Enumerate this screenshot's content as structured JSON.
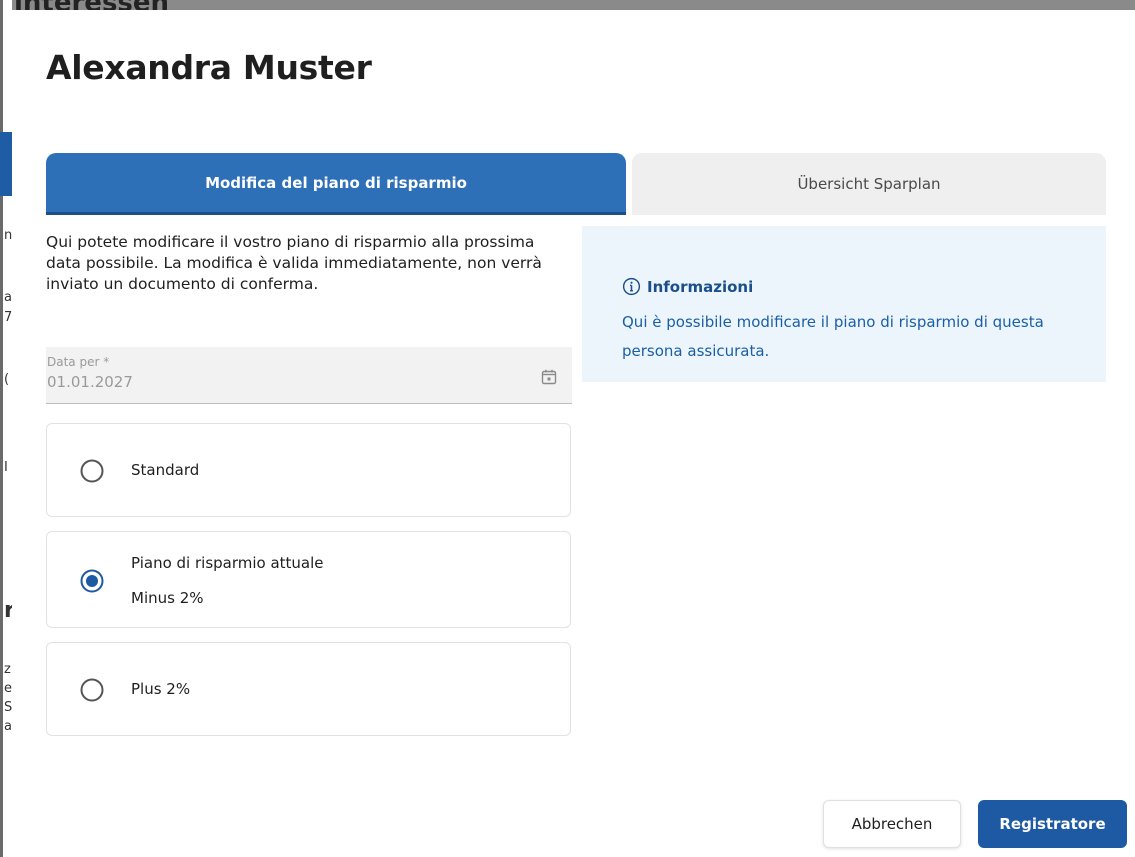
{
  "background": {
    "title_fragment": "interessen",
    "fragments": [
      "n",
      "a",
      "7",
      "(",
      "I",
      "r",
      "z",
      "e",
      "S",
      "a"
    ]
  },
  "modal": {
    "title": "Alexandra Muster",
    "tabs": [
      {
        "label": "Modifica del piano di risparmio",
        "active": true
      },
      {
        "label": "Übersicht Sparplan",
        "active": false
      }
    ],
    "description": "Qui potete modificare il vostro piano di risparmio alla prossima data possibile. La modifica è valida immediatamente, non verrà inviato un documento di conferma.",
    "date_field": {
      "label": "Data per *",
      "value": "01.01.2027",
      "icon": "calendar-icon"
    },
    "options": [
      {
        "label": "Standard",
        "sublabel": "",
        "selected": false
      },
      {
        "label": "Piano di risparmio attuale",
        "sublabel": "Minus 2%",
        "selected": true
      },
      {
        "label": "Plus 2%",
        "sublabel": "",
        "selected": false
      }
    ],
    "info": {
      "icon": "info-circle-icon",
      "title": "Informazioni",
      "text": "Qui è possibile modificare il piano di risparmio di questa persona assicurata."
    },
    "buttons": {
      "cancel": "Abbrechen",
      "submit": "Registratore"
    }
  },
  "colors": {
    "primary": "#1e5aa3",
    "tab_active": "#2e70b8",
    "info_bg": "#edf5fc",
    "info_text": "#1a5fa6"
  }
}
